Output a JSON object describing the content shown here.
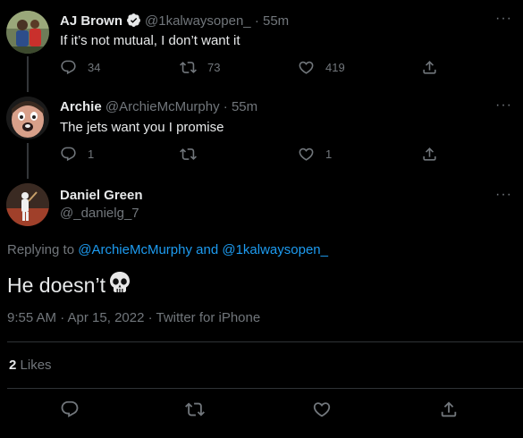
{
  "tweets": [
    {
      "name": "AJ Brown",
      "handle": "@1kalwaysopen_",
      "time": "· 55m",
      "text": "If it’s not mutual, I don’t want it",
      "replies": "34",
      "retweets": "73",
      "likes": "419",
      "verified": true
    },
    {
      "name": "Archie",
      "handle": "@ArchieMcMurphy",
      "time": "· 55m",
      "text": "The jets want you I promise",
      "replies": "1",
      "retweets": "",
      "likes": "1",
      "verified": false
    }
  ],
  "main": {
    "name": "Daniel Green",
    "handle": "@_danielg_7",
    "replying_prefix": "Replying to",
    "replying_user1": "@ArchieMcMurphy",
    "replying_and": "and",
    "replying_user2": "@1kalwaysopen_",
    "text": "He doesn’t",
    "emoji": "skull-icon",
    "timestamp": "9:55 AM · Apr 15, 2022 · Twitter for iPhone",
    "likes_count": "2",
    "likes_label": "Likes"
  },
  "more_label": "···",
  "colors": {
    "background": "#000000",
    "text": "#e7e9ea",
    "secondary": "#71767b",
    "link": "#1d9bf0",
    "verified": "#e7e9ea"
  }
}
